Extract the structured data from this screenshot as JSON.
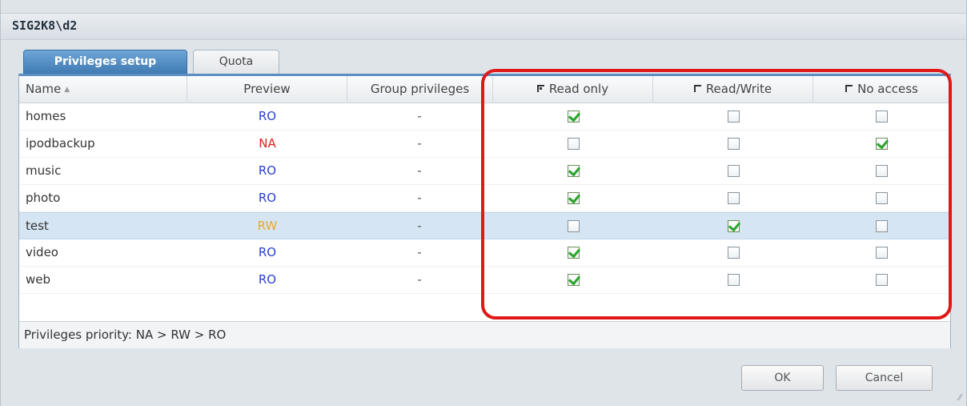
{
  "window": {
    "title": "SIG2K8\\d2"
  },
  "tabs": [
    {
      "label": "Privileges setup",
      "active": true
    },
    {
      "label": "Quota",
      "active": false
    }
  ],
  "columns": {
    "name": "Name",
    "preview": "Preview",
    "group": "Group privileges",
    "read_only": "Read only",
    "read_write": "Read/Write",
    "no_access": "No access"
  },
  "header_checks": {
    "read_only": true,
    "read_write": false,
    "no_access": false
  },
  "preview_colors": {
    "RO": "#2a3fd1",
    "NA": "#e02020",
    "RW": "#e8a92a"
  },
  "rows": [
    {
      "name": "homes",
      "preview": "RO",
      "group": "-",
      "read_only": true,
      "read_write": false,
      "no_access": false
    },
    {
      "name": "ipodbackup",
      "preview": "NA",
      "group": "-",
      "read_only": false,
      "read_write": false,
      "no_access": true
    },
    {
      "name": "music",
      "preview": "RO",
      "group": "-",
      "read_only": true,
      "read_write": false,
      "no_access": false
    },
    {
      "name": "photo",
      "preview": "RO",
      "group": "-",
      "read_only": true,
      "read_write": false,
      "no_access": false
    },
    {
      "name": "test",
      "preview": "RW",
      "group": "-",
      "read_only": false,
      "read_write": true,
      "no_access": false,
      "selected": true
    },
    {
      "name": "video",
      "preview": "RO",
      "group": "-",
      "read_only": true,
      "read_write": false,
      "no_access": false
    },
    {
      "name": "web",
      "preview": "RO",
      "group": "-",
      "read_only": true,
      "read_write": false,
      "no_access": false
    }
  ],
  "footer_note": "Privileges priority: NA > RW > RO",
  "buttons": {
    "ok": "OK",
    "cancel": "Cancel"
  },
  "highlight_color": "#e01818"
}
